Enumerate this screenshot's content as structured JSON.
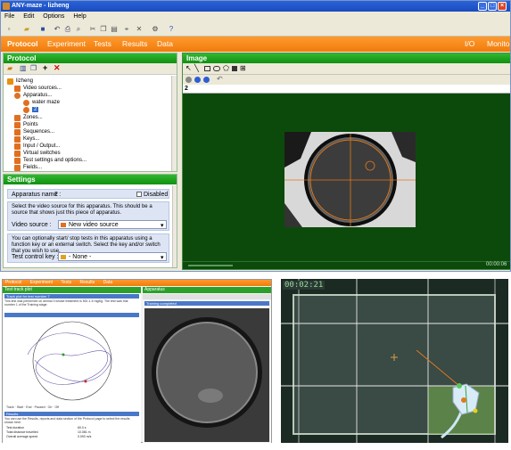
{
  "window": {
    "title": "ANY-maze - lizheng"
  },
  "menubar": [
    "File",
    "Edit",
    "Options",
    "Help"
  ],
  "nav": {
    "tabs": [
      "Protocol",
      "Experiment",
      "Tests",
      "Results",
      "Data"
    ],
    "right": [
      "I/O",
      "Monitor"
    ]
  },
  "protocol_panel": {
    "title": "Protocol",
    "tree": [
      "lizheng",
      "Video sources...",
      "Apparatus...",
      "water maze",
      "2",
      "Zones...",
      "Points",
      "Sequences...",
      "Keys...",
      "Input / Output...",
      "Virtual switches",
      "Test settings and options...",
      "Fields..."
    ]
  },
  "settings_panel": {
    "title": "Settings",
    "apparatus_label": "Apparatus name :",
    "apparatus_value": "2",
    "disabled_label": "Disabled",
    "video_help": "Select the video source for this apparatus. This should be a source that shows just this piece of apparatus.",
    "video_label": "Video source :",
    "video_value": "New video source",
    "key_help": "You can optionally start/ stop tests in this apparatus using a function key or an external switch. Select the key and/or switch that you wish to use.",
    "control_label": "Test control key :",
    "control_value": "- None -"
  },
  "image_panel": {
    "title": "Image",
    "layer": "2",
    "time": "00:00:06"
  },
  "track_window": {
    "tabs": [
      "Protocol",
      "Experiment",
      "Tests",
      "Results",
      "Data"
    ],
    "left_title": "Test track plot",
    "section": "Track plot for test number 7",
    "description": "This test was performed on animal 3 whose treatment is 5Gr-1.5 mg/kg. The test was trial number 1 of the Training stage.",
    "legend": [
      "Track",
      "Start",
      "End",
      "Paused",
      "On",
      "Off"
    ],
    "results_title": "Results",
    "results_text": "You can use the Results, reports and data section of the Protocol page to select the results shown here.",
    "results": [
      {
        "label": "Test duration",
        "value": "60.0 s"
      },
      {
        "label": "Total distance travelled",
        "value": "10.081 m"
      },
      {
        "label": "Overall average speed",
        "value": "0.093 m/s"
      }
    ],
    "right_title": "Apparatus",
    "status": "Training completed"
  },
  "camera": {
    "timestamp": "00:02:21"
  }
}
